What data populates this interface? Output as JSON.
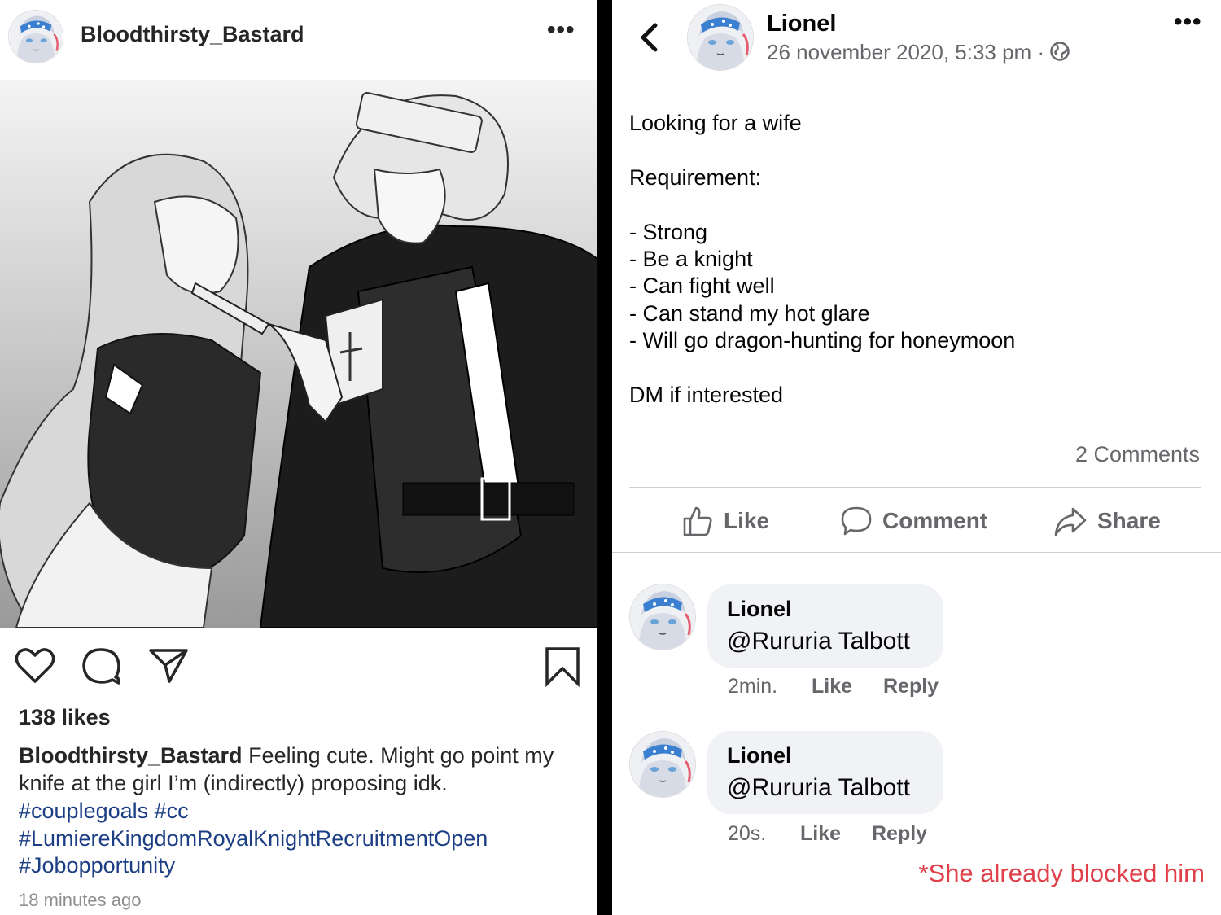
{
  "instagram": {
    "username": "Bloodthirsty_Bastard",
    "more_icon": "more-horizontal-icon",
    "icons": {
      "like": "heart-icon",
      "comment": "speech-bubble-icon",
      "share": "paper-plane-icon",
      "save": "bookmark-icon"
    },
    "likes": "138 likes",
    "caption_user": "Bloodthirsty_Bastard",
    "caption_text": " Feeling cute. Might go point my knife at the girl I’m (indirectly) proposing idk.",
    "hashtags": [
      "#couplegoals",
      "#cc",
      "#LumiereKingdomRoyalKnightRecruitmentOpen",
      "#Jobopportunity"
    ],
    "time": "18 minutes ago"
  },
  "facebook": {
    "back_icon": "chevron-left-icon",
    "author": "Lionel",
    "date": "26 november 2020, 5:33 pm ·",
    "privacy_icon": "globe-icon",
    "post_lines": [
      "Looking for a wife",
      "Requirement:",
      "- Strong",
      "- Be a knight",
      "- Can fight well",
      "- Can stand my hot glare",
      "- Will go dragon-hunting for honeymoon",
      "DM if interested"
    ],
    "comments_count": "2 Comments",
    "actions": {
      "like": "Like",
      "comment": "Comment",
      "share": "Share"
    },
    "comments": [
      {
        "name": "Lionel",
        "text": "@Rururia Talbott",
        "age": "2min.",
        "like": "Like",
        "reply": "Reply"
      },
      {
        "name": "Lionel",
        "text": "@Rururia Talbott",
        "age": "20s.",
        "like": "Like",
        "reply": "Reply"
      }
    ]
  },
  "annotation": "*She already blocked him",
  "colors": {
    "hashtag": "#1c3e84",
    "note": "#e0404a",
    "fb_gray": "#65676b",
    "bubble": "#f0f2f5"
  }
}
